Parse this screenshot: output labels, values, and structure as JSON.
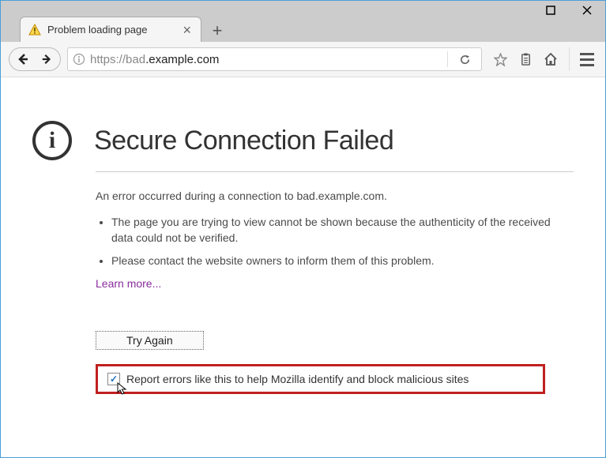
{
  "window": {
    "tab_title": "Problem loading page"
  },
  "toolbar": {
    "url_prefix": "https://bad",
    "url_domain": ".example.com"
  },
  "page": {
    "heading": "Secure Connection Failed",
    "intro": "An error occurred during a connection to bad.example.com.",
    "bullets": [
      "The page you are trying to view cannot be shown because the authenticity of the received data could not be verified.",
      "Please contact the website owners to inform them of this problem."
    ],
    "learn_more": "Learn more...",
    "try_again": "Try Again",
    "report_label": "Report errors like this to help Mozilla identify and block malicious sites",
    "report_checked": true
  }
}
